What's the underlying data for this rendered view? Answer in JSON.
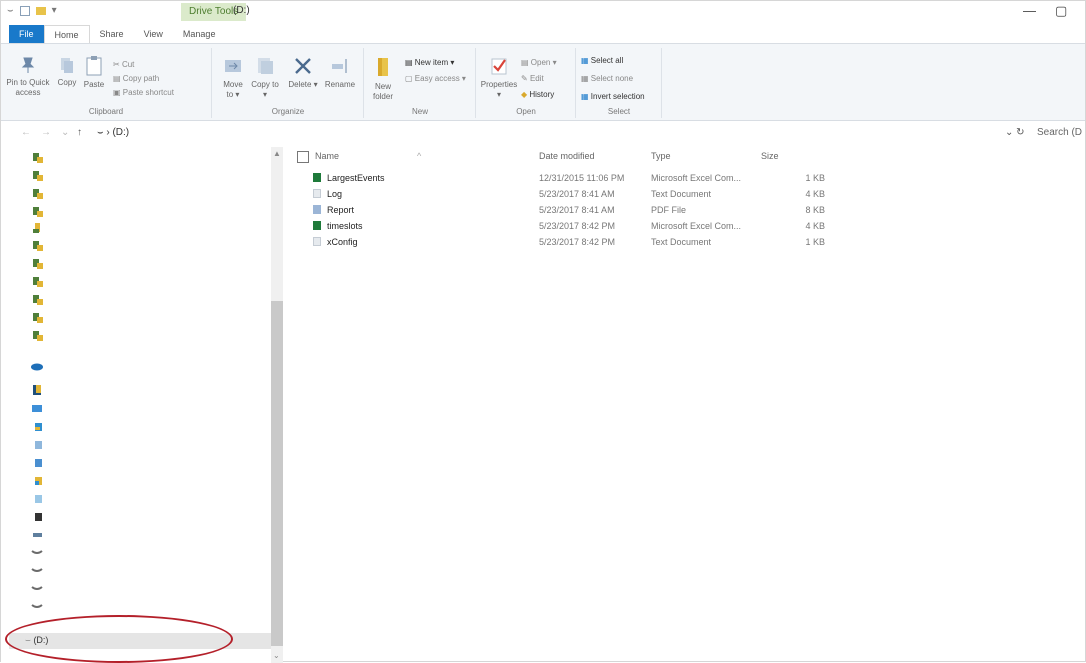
{
  "window": {
    "context_tab": "Drive Tools",
    "title": "(D:)",
    "minimize": "—",
    "maximize": "▢"
  },
  "ribbon_tabs": [
    "File",
    "Home",
    "Share",
    "View",
    "Manage"
  ],
  "ribbon": {
    "clipboard": {
      "pin": "Pin to Quick access",
      "copy": "Copy",
      "paste": "Paste",
      "cut": "Cut",
      "copy_path": "Copy path",
      "paste_shortcut": "Paste shortcut",
      "label": "Clipboard"
    },
    "organize": {
      "move_to": "Move to ▾",
      "copy_to": "Copy to ▾",
      "delete": "Delete ▾",
      "rename": "Rename",
      "label": "Organize"
    },
    "new": {
      "new_folder": "New folder",
      "new_item": "New item ▾",
      "easy_access": "Easy access ▾",
      "label": "New"
    },
    "open": {
      "properties": "Properties ▾",
      "open": "Open ▾",
      "edit": "Edit",
      "history": "History",
      "label": "Open"
    },
    "select": {
      "select_all": "Select all",
      "select_none": "Select none",
      "invert": "Invert selection",
      "label": "Select"
    }
  },
  "address": {
    "back": "←",
    "forward": "→",
    "recent": "⌄",
    "up": "↑",
    "path": "(D:)",
    "refresh": "⌄  ↻",
    "search": "Search (D"
  },
  "nav": {
    "selected": "(D:)"
  },
  "columns": {
    "name": "Name",
    "date": "Date modified",
    "type": "Type",
    "size": "Size"
  },
  "files": [
    {
      "name": "LargestEvents",
      "date": "12/31/2015 11:06 PM",
      "type": "Microsoft Excel Com...",
      "size": "1 KB",
      "icon": "excel-icon",
      "color": "#1e7a3a"
    },
    {
      "name": "Log",
      "date": "5/23/2017 8:41 AM",
      "type": "Text Document",
      "size": "4 KB",
      "icon": "text-file-icon",
      "color": "#cfd6de"
    },
    {
      "name": "Report",
      "date": "5/23/2017 8:41 AM",
      "type": "PDF File",
      "size": "8 KB",
      "icon": "pdf-icon",
      "color": "#9bb5d6"
    },
    {
      "name": "timeslots",
      "date": "5/23/2017 8:42 PM",
      "type": "Microsoft Excel Com...",
      "size": "4 KB",
      "icon": "excel-icon",
      "color": "#1e7a3a"
    },
    {
      "name": "xConfig",
      "date": "5/23/2017 8:42 PM",
      "type": "Text Document",
      "size": "1 KB",
      "icon": "text-file-icon",
      "color": "#cfd6de"
    }
  ],
  "colors": {
    "file_tab": "#1979ca",
    "context_tab_bg": "#dbeacb",
    "highlight_circle": "#b4202a"
  }
}
